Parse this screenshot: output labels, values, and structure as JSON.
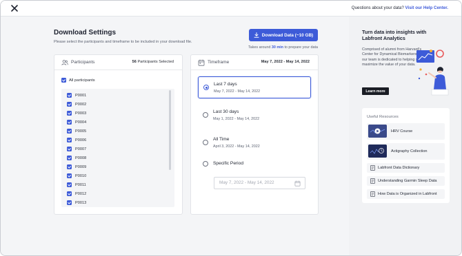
{
  "topbar": {
    "question": "Questions about your data?",
    "help_link": "Visit our Help Center."
  },
  "main": {
    "title": "Download Settings",
    "subtitle": "Please select the participants and timeframe to be included in your download file.",
    "download_button": "Download Data (~10 GB)",
    "takes_prefix": "Takes around",
    "takes_time": "30 min",
    "takes_suffix": "to prepare your data"
  },
  "participants": {
    "header": "Participants",
    "selected_count": "56",
    "selected_suffix": "Participants Selected",
    "all_label": "All participants",
    "items": [
      "P0001",
      "P0002",
      "P0003",
      "P0004",
      "P0005",
      "P0006",
      "P0007",
      "P0008",
      "P0009",
      "P0010",
      "P0011",
      "P0012",
      "P0013"
    ]
  },
  "timeframe": {
    "header": "Timeframe",
    "range": "May 7, 2022 - May 14, 2022",
    "options": [
      {
        "label": "Last 7 days",
        "date": "May 7, 2022 - May 14, 2022",
        "selected": true
      },
      {
        "label": "Last 30 days",
        "date": "May 1, 2022 - May 14, 2022",
        "selected": false
      },
      {
        "label": "All Time",
        "date": "April 3, 2022 - May 14, 2022",
        "selected": false
      },
      {
        "label": "Specific Period",
        "date": "",
        "selected": false
      }
    ],
    "specific_placeholder": "May 7, 2022 - May 14, 2022"
  },
  "sidebar": {
    "promo_title": "Turn data into insights with Labfront Analytics",
    "promo_text": "Comprised of alumni from Harvard's Center for Dynamical Biomarkers, our team is dedicated to helping you maximize the value of your data.",
    "learn_more": "Learn more",
    "resources_title": "Useful Resources",
    "resources": [
      {
        "label": "HRV Course"
      },
      {
        "label": "Actigraphy Collection"
      },
      {
        "label": "Labfront Data Dictionary"
      },
      {
        "label": "Understanding Garmin Sleep Data"
      },
      {
        "label": "How Data is Organized in Labfront"
      }
    ]
  },
  "colors": {
    "accent": "#3d5bd8",
    "dark_button": "#1a1d24",
    "panel_bg": "#f4f5f7"
  }
}
